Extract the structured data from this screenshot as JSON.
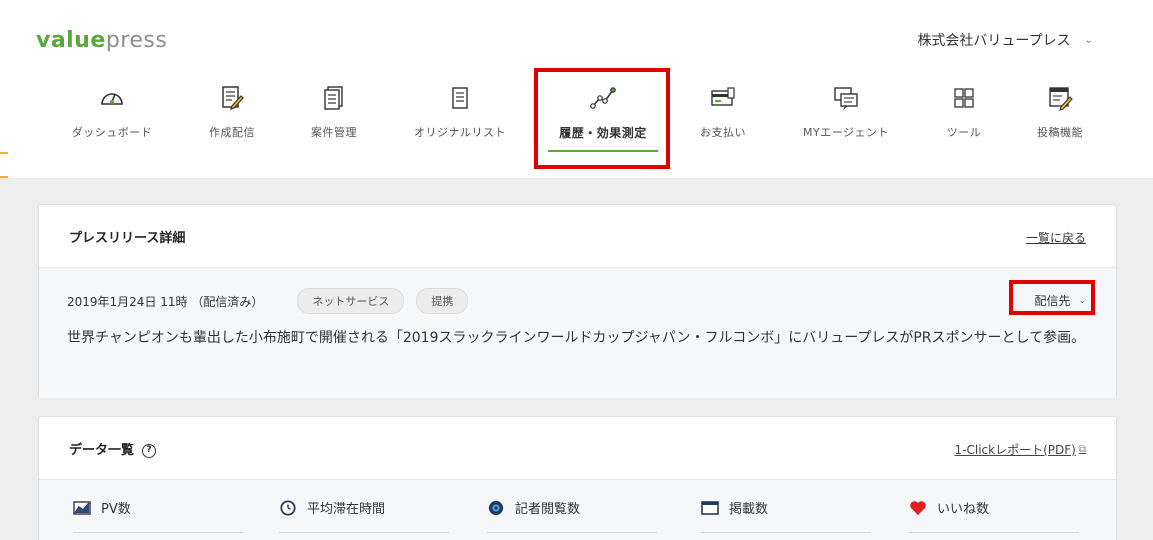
{
  "header": {
    "logo": {
      "part1": "value",
      "part2": "press"
    },
    "company": {
      "name": "株式会社バリュープレス",
      "chevron": "⌄"
    }
  },
  "nav": {
    "items": [
      {
        "label": "ダッシュボード",
        "icon": "gauge-icon"
      },
      {
        "label": "作成配信",
        "icon": "edit-document-icon"
      },
      {
        "label": "案件管理",
        "icon": "documents-icon"
      },
      {
        "label": "オリジナルリスト",
        "icon": "list-icon"
      },
      {
        "label": "履歴・効果測定",
        "icon": "line-chart-icon",
        "active": true
      },
      {
        "label": "お支払い",
        "icon": "payment-icon"
      },
      {
        "label": "MYエージェント",
        "icon": "chat-icon"
      },
      {
        "label": "ツール",
        "icon": "grid-icon"
      },
      {
        "label": "投稿機能",
        "icon": "post-icon"
      }
    ]
  },
  "release": {
    "title": "プレスリリース詳細",
    "back_label": "一覧に戻る",
    "date": "2019年1月24日 11時 （配信済み）",
    "tags": [
      "ネットサービス",
      "提携"
    ],
    "destination_label": "配信先",
    "headline": "世界チャンピオンも輩出した小布施町で開催される「2019スラックラインワールドカップジャパン・フルコンボ」にバリュープレスがPRスポンサーとして参画。"
  },
  "data_list": {
    "title": "データ一覧",
    "help_glyph": "?",
    "report_label": "1-Clickレポート(PDF)",
    "metrics": [
      {
        "label": "PV数",
        "icon": "chart-image-icon"
      },
      {
        "label": "平均滞在時間",
        "icon": "clock-icon"
      },
      {
        "label": "記者閲覧数",
        "icon": "eye-icon"
      },
      {
        "label": "掲載数",
        "icon": "window-icon"
      },
      {
        "label": "いいね数",
        "icon": "heart-icon"
      }
    ]
  },
  "colors": {
    "brand_green": "#58a83b",
    "highlight_red": "#e00000",
    "page_gray": "#eeeeee"
  }
}
